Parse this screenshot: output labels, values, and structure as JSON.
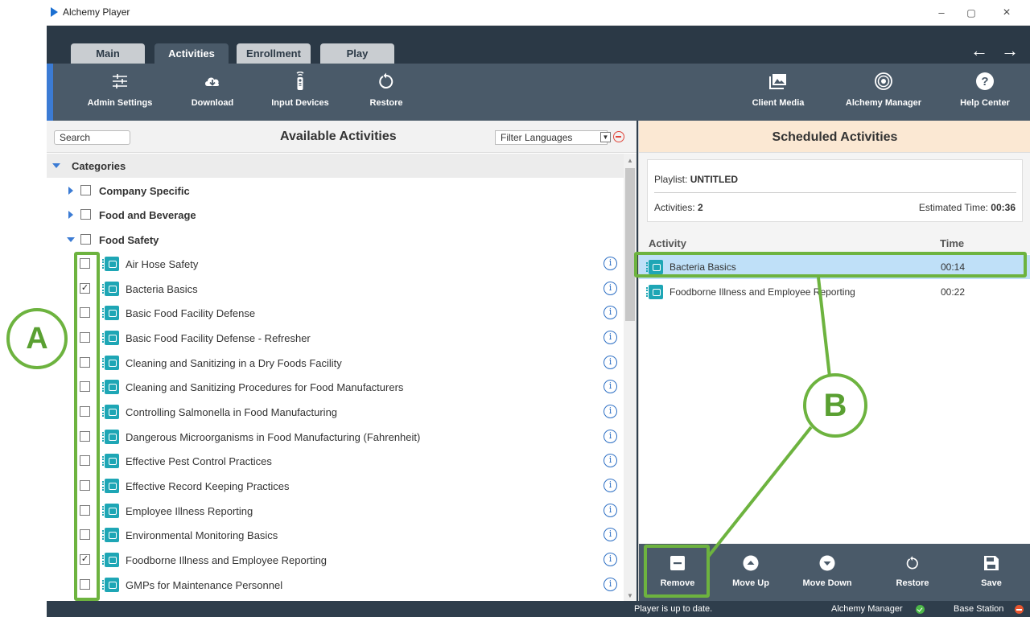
{
  "window": {
    "title": "Alchemy Player",
    "minimize": "–",
    "restore": "▢",
    "close": "×"
  },
  "tabs": [
    "Main",
    "Activities",
    "Enrollment",
    "Play"
  ],
  "nav": {
    "back": "←",
    "forward": "→"
  },
  "toolbar": {
    "admin_settings": "Admin Settings",
    "download": "Download",
    "input_devices": "Input Devices",
    "restore": "Restore",
    "client_media": "Client Media",
    "alchemy_manager": "Alchemy Manager",
    "help_center": "Help Center"
  },
  "available": {
    "search_placeholder": "Search",
    "title": "Available Activities",
    "filter_languages": "Filter Languages",
    "root_category": "Categories",
    "categories": [
      "Company Specific",
      "Food and Beverage",
      "Food Safety"
    ],
    "activities": [
      {
        "name": "Air Hose Safety",
        "checked": ""
      },
      {
        "name": "Bacteria Basics",
        "checked": "✓"
      },
      {
        "name": "Basic Food Facility Defense",
        "checked": ""
      },
      {
        "name": "Basic Food Facility Defense - Refresher",
        "checked": ""
      },
      {
        "name": "Cleaning and Sanitizing in a Dry Foods Facility",
        "checked": ""
      },
      {
        "name": "Cleaning and Sanitizing Procedures for Food Manufacturers",
        "checked": ""
      },
      {
        "name": "Controlling Salmonella in Food Manufacturing",
        "checked": ""
      },
      {
        "name": "Dangerous Microorganisms in Food Manufacturing (Fahrenheit)",
        "checked": ""
      },
      {
        "name": "Effective Pest Control Practices",
        "checked": ""
      },
      {
        "name": "Effective Record Keeping Practices",
        "checked": ""
      },
      {
        "name": "Employee Illness Reporting",
        "checked": ""
      },
      {
        "name": "Environmental Monitoring Basics",
        "checked": ""
      },
      {
        "name": "Foodborne Illness and Employee Reporting",
        "checked": "✓"
      },
      {
        "name": "GMPs for Maintenance Personnel",
        "checked": ""
      }
    ],
    "info_glyph": "i"
  },
  "scheduled": {
    "title": "Scheduled Activities",
    "playlist_label": "Playlist: ",
    "playlist_name": "UNTITLED",
    "activities_label": "Activities: ",
    "activities_count": "2",
    "estimated_label": "Estimated Time: ",
    "estimated_time": "00:36",
    "col_activity": "Activity",
    "col_time": "Time",
    "rows": [
      {
        "name": "Bacteria Basics",
        "time": "00:14"
      },
      {
        "name": "Foodborne Illness and Employee Reporting",
        "time": "00:22"
      }
    ],
    "buttons": {
      "remove": "Remove",
      "move_up": "Move Up",
      "move_down": "Move Down",
      "restore": "Restore",
      "save": "Save"
    }
  },
  "status": {
    "message": "Player is up to date.",
    "alchemy_manager": "Alchemy Manager",
    "base_station": "Base Station"
  },
  "annotations": {
    "a": "A",
    "b": "B"
  },
  "colors": {
    "accent": "#6db33f",
    "toolbar": "#4a5a69",
    "selection": "#bfe0f8",
    "activity_icon": "#1ea6b5"
  }
}
